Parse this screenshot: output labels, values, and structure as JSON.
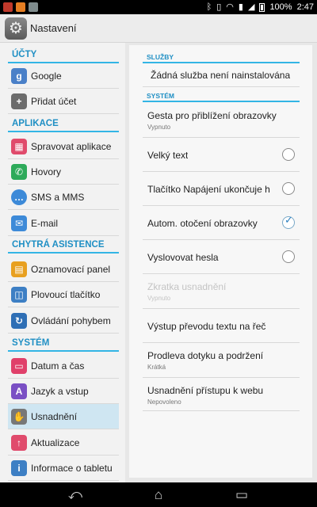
{
  "status_bar": {
    "battery": "100%",
    "time": "2:47"
  },
  "action_bar": {
    "title": "Nastavení",
    "icon": "settings-gear-icon"
  },
  "left_pane": {
    "categories": [
      "ÚČTY",
      "APLIKACE",
      "CHYTRÁ ASISTENCE",
      "SYSTÉM"
    ],
    "items": [
      {
        "label": "Google",
        "icon": "google-icon"
      },
      {
        "label": "Přidat účet",
        "icon": "add-icon"
      },
      {
        "label": "Spravovat aplikace",
        "icon": "apps-icon"
      },
      {
        "label": "Hovory",
        "icon": "phone-icon"
      },
      {
        "label": "SMS a MMS",
        "icon": "message-icon"
      },
      {
        "label": "E-mail",
        "icon": "email-icon"
      },
      {
        "label": "Oznamovací panel",
        "icon": "notification-panel-icon"
      },
      {
        "label": "Plovoucí tlačítko",
        "icon": "floating-button-icon"
      },
      {
        "label": "Ovládání pohybem",
        "icon": "motion-control-icon"
      },
      {
        "label": "Datum a čas",
        "icon": "calendar-icon"
      },
      {
        "label": "Jazyk a vstup",
        "icon": "language-icon"
      },
      {
        "label": "Usnadnění",
        "icon": "accessibility-hand-icon",
        "selected": true
      },
      {
        "label": "Aktualizace",
        "icon": "update-icon"
      },
      {
        "label": "Informace o tabletu",
        "icon": "info-icon"
      }
    ]
  },
  "right_pane": {
    "sections": [
      {
        "header": "SLUŽBY",
        "rows": [
          {
            "title": "Žádná služba není nainstalována"
          }
        ]
      },
      {
        "header": "SYSTÉM",
        "rows": [
          {
            "title": "Gesta pro přiblížení obrazovky",
            "subtitle": "Vypnuto"
          },
          {
            "title": "Velký text",
            "checked": false
          },
          {
            "title": "Tlačítko Napájení ukončuje h",
            "checked": false
          },
          {
            "title": "Autom. otočení obrazovky",
            "checked": true
          },
          {
            "title": "Vyslovovat hesla",
            "checked": false
          },
          {
            "title": "Zkratka usnadnění",
            "subtitle": "Vypnuto",
            "disabled": true
          },
          {
            "title": "Výstup převodu textu na řeč"
          },
          {
            "title": "Prodleva dotyku a podržení",
            "subtitle": "Krátká"
          },
          {
            "title": "Usnadnění přístupu k webu",
            "subtitle": "Nepovoleno"
          }
        ]
      }
    ]
  },
  "nav_bar": {
    "buttons": [
      "back-icon",
      "home-icon",
      "recent-apps-icon"
    ]
  },
  "colors": {
    "accent": "#33b5e5",
    "category_text": "#1f8fc4",
    "selected_item": "#cfe6f2"
  }
}
